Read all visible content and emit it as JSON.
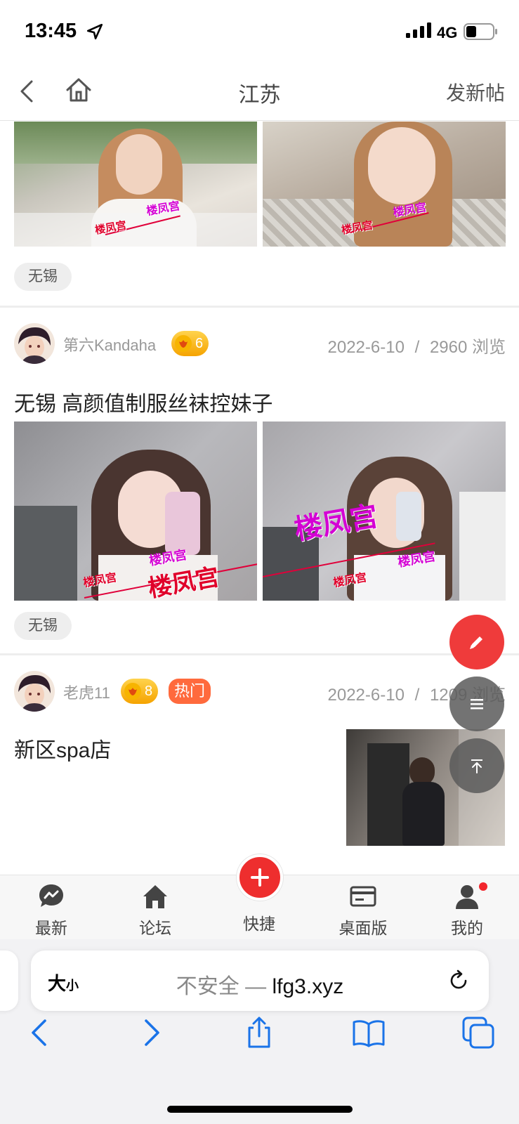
{
  "status": {
    "time": "13:45",
    "network": "4G"
  },
  "nav": {
    "title": "江苏",
    "post_button": "发新帖"
  },
  "posts": [
    {
      "tag": "无锡"
    },
    {
      "author": "第六Kandaha",
      "level": "6",
      "date": "2022-6-10",
      "separator": "/",
      "views": "2960 浏览",
      "title": "无锡 高颜值制服丝袜控妹子",
      "tag": "无锡"
    },
    {
      "author": "老虎11",
      "level": "8",
      "hot_label": "热门",
      "date": "2022-6-10",
      "separator": "/",
      "views": "1209 浏览",
      "title": "新区spa店"
    }
  ],
  "watermark": "楼凤宫",
  "tabbar": {
    "items": [
      {
        "label": "最新",
        "icon": "chat-bubble-icon"
      },
      {
        "label": "论坛",
        "icon": "home-icon"
      },
      {
        "label": "快捷",
        "icon": "plus-icon"
      },
      {
        "label": "桌面版",
        "icon": "card-icon"
      },
      {
        "label": "我的",
        "icon": "user-icon"
      }
    ]
  },
  "browser": {
    "text_size": "大",
    "text_size_small": "小",
    "security": "不安全 —",
    "domain": "lfg3.xyz"
  },
  "colors": {
    "accent": "#ef3b3b",
    "level_badge": "#f5a300",
    "hot_badge": "#ff6a3d",
    "link_blue": "#1a73e8"
  }
}
